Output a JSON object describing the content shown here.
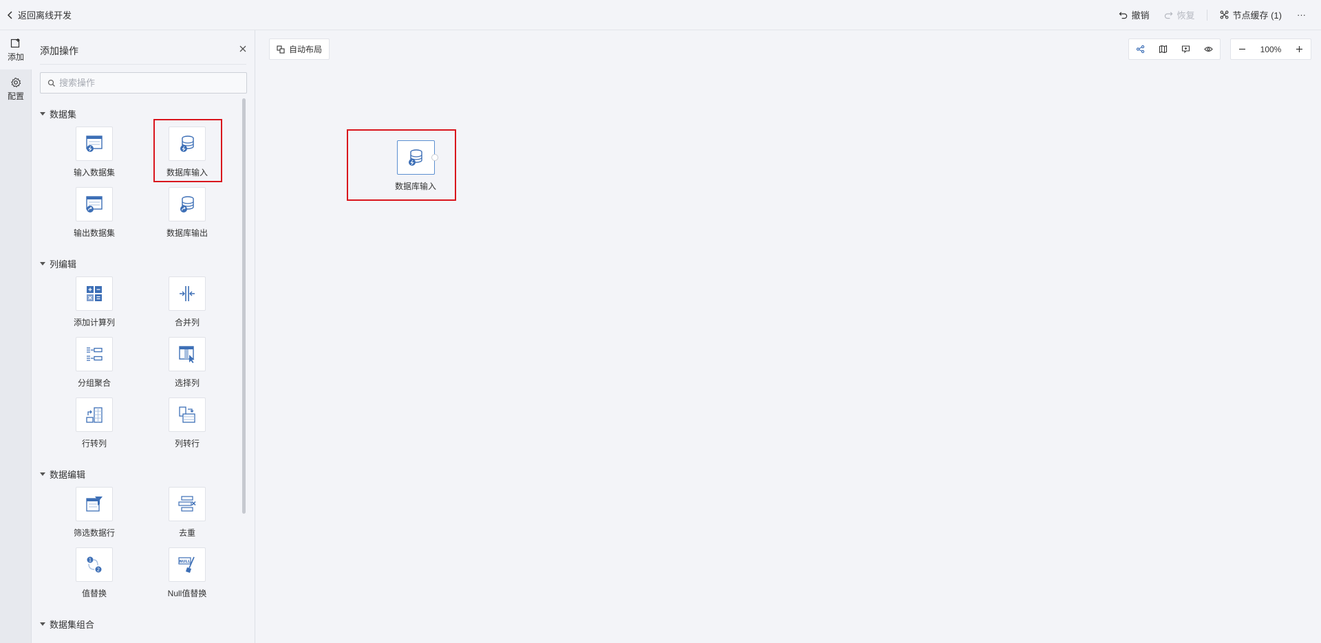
{
  "topbar": {
    "back_label": "返回离线开发",
    "undo_label": "撤销",
    "redo_label": "恢复",
    "cache_label": "节点缓存 (1)",
    "more_label": "···"
  },
  "rail": {
    "add_label": "添加",
    "config_label": "配置"
  },
  "panel": {
    "title": "添加操作",
    "search_placeholder": "搜索操作",
    "sections": [
      {
        "title": "数据集",
        "items": [
          "输入数据集",
          "数据库输入",
          "输出数据集",
          "数据库输出"
        ]
      },
      {
        "title": "列编辑",
        "items": [
          "添加计算列",
          "合并列",
          "分组聚合",
          "选择列",
          "行转列",
          "列转行"
        ]
      },
      {
        "title": "数据编辑",
        "items": [
          "筛选数据行",
          "去重",
          "值替换",
          "Null值替换"
        ]
      },
      {
        "title": "数据集组合",
        "items": []
      }
    ]
  },
  "canvas": {
    "auto_layout_label": "自动布局",
    "zoom": "100%",
    "node_label": "数据库输入"
  },
  "colors": {
    "accent": "#3d6fb6",
    "highlight": "#d9141c"
  }
}
